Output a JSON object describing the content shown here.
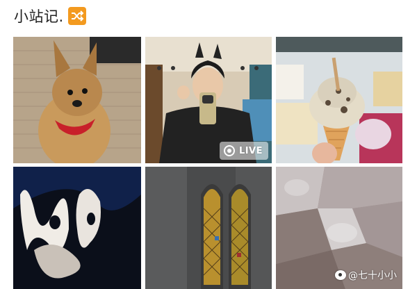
{
  "post": {
    "title": "小站记.",
    "title_emoji": "shuffle-tracks-emoji",
    "emoji_color": "#f39a1f"
  },
  "photos": [
    {
      "subject": "yorkshire-terrier-dog",
      "badge": ""
    },
    {
      "subject": "man-selfie-in-shop",
      "badge": "LIVE"
    },
    {
      "subject": "ice-cream-cone-gelato",
      "badge": ""
    },
    {
      "subject": "abstract-dark-light-swirl",
      "badge": ""
    },
    {
      "subject": "stained-glass-church-window",
      "badge": ""
    },
    {
      "subject": "abstract-glass-texture",
      "badge": ""
    }
  ],
  "watermark": {
    "icon": "weibo-icon",
    "text": "@七十小小"
  }
}
